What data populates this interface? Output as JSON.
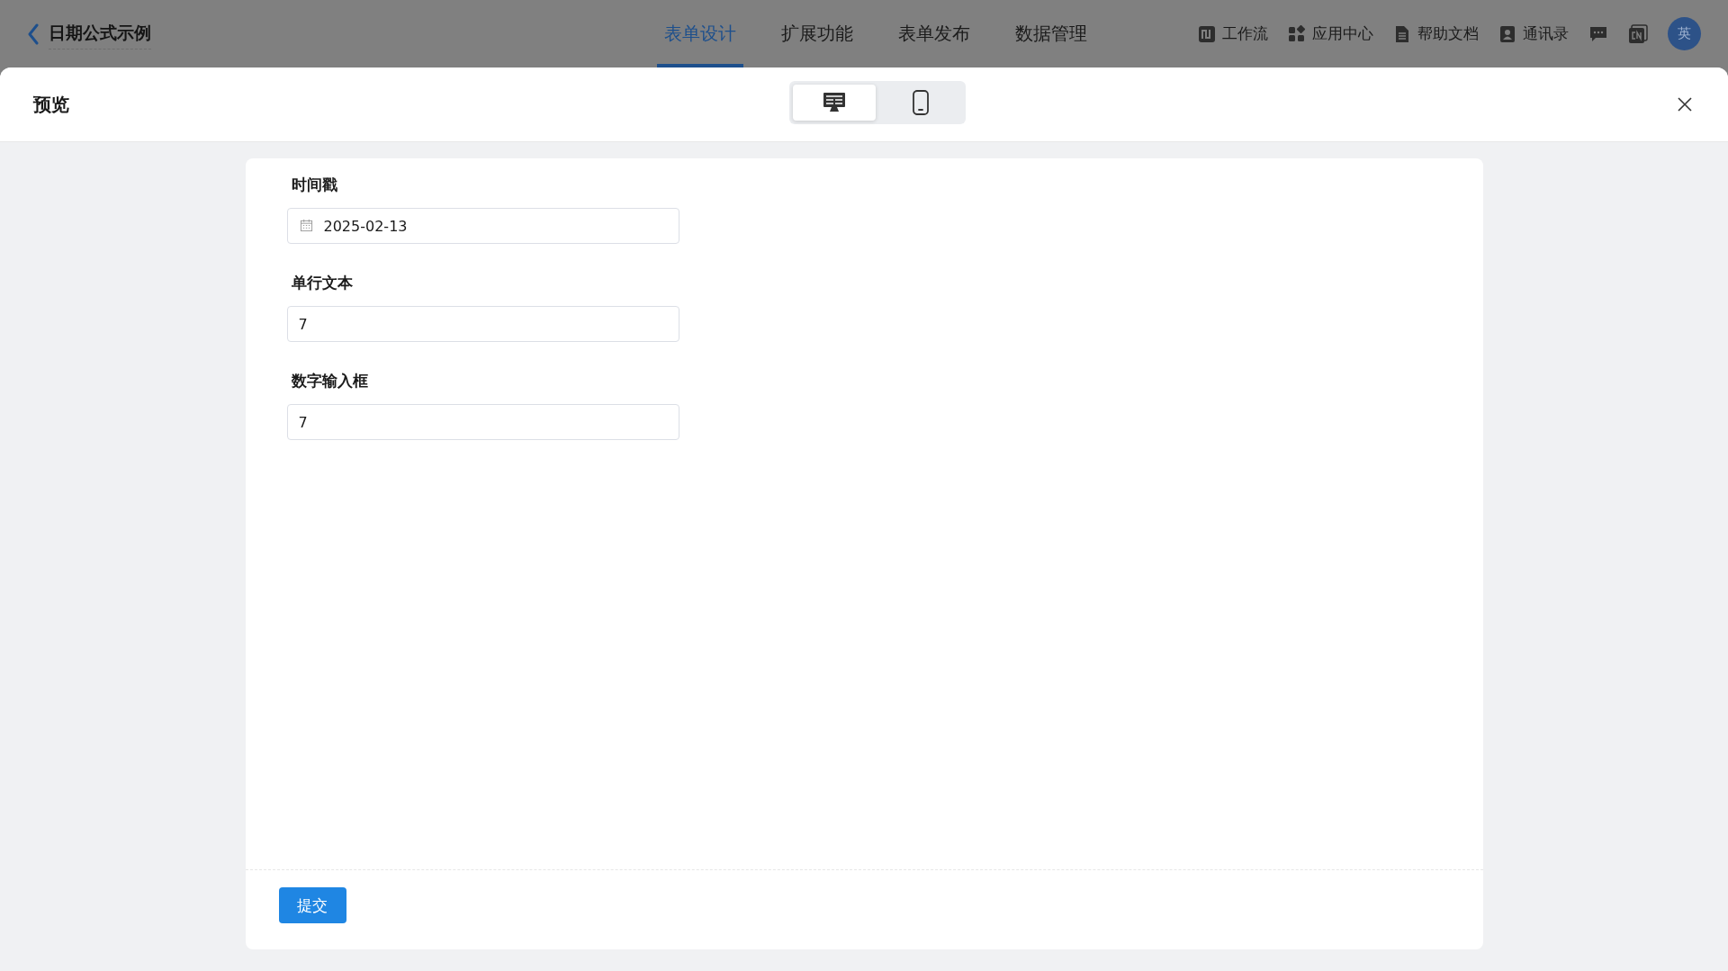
{
  "app_bar": {
    "title": "日期公式示例",
    "tabs": [
      {
        "label": "表单设计",
        "selected": true
      },
      {
        "label": "扩展功能",
        "selected": false
      },
      {
        "label": "表单发布",
        "selected": false
      },
      {
        "label": "数据管理",
        "selected": false
      }
    ],
    "tools": [
      {
        "kind": "workflow",
        "label": "工作流"
      },
      {
        "kind": "apps",
        "label": "应用中心"
      },
      {
        "kind": "docs",
        "label": "帮助文档"
      },
      {
        "kind": "contacts",
        "label": "通讯录"
      },
      {
        "kind": "chat"
      },
      {
        "kind": "language"
      }
    ],
    "avatar": "英"
  },
  "dialog": {
    "title": "预览",
    "views": [
      {
        "kind": "desktop",
        "selected": true
      },
      {
        "kind": "mobile",
        "selected": false
      }
    ],
    "fields": [
      {
        "kind": "date",
        "label": "时间戳",
        "value": "2025-02-13"
      },
      {
        "kind": "text",
        "label": "单行文本",
        "value": "7"
      },
      {
        "kind": "number",
        "label": "数字输入框",
        "value": "7"
      }
    ],
    "submit": "提交"
  }
}
